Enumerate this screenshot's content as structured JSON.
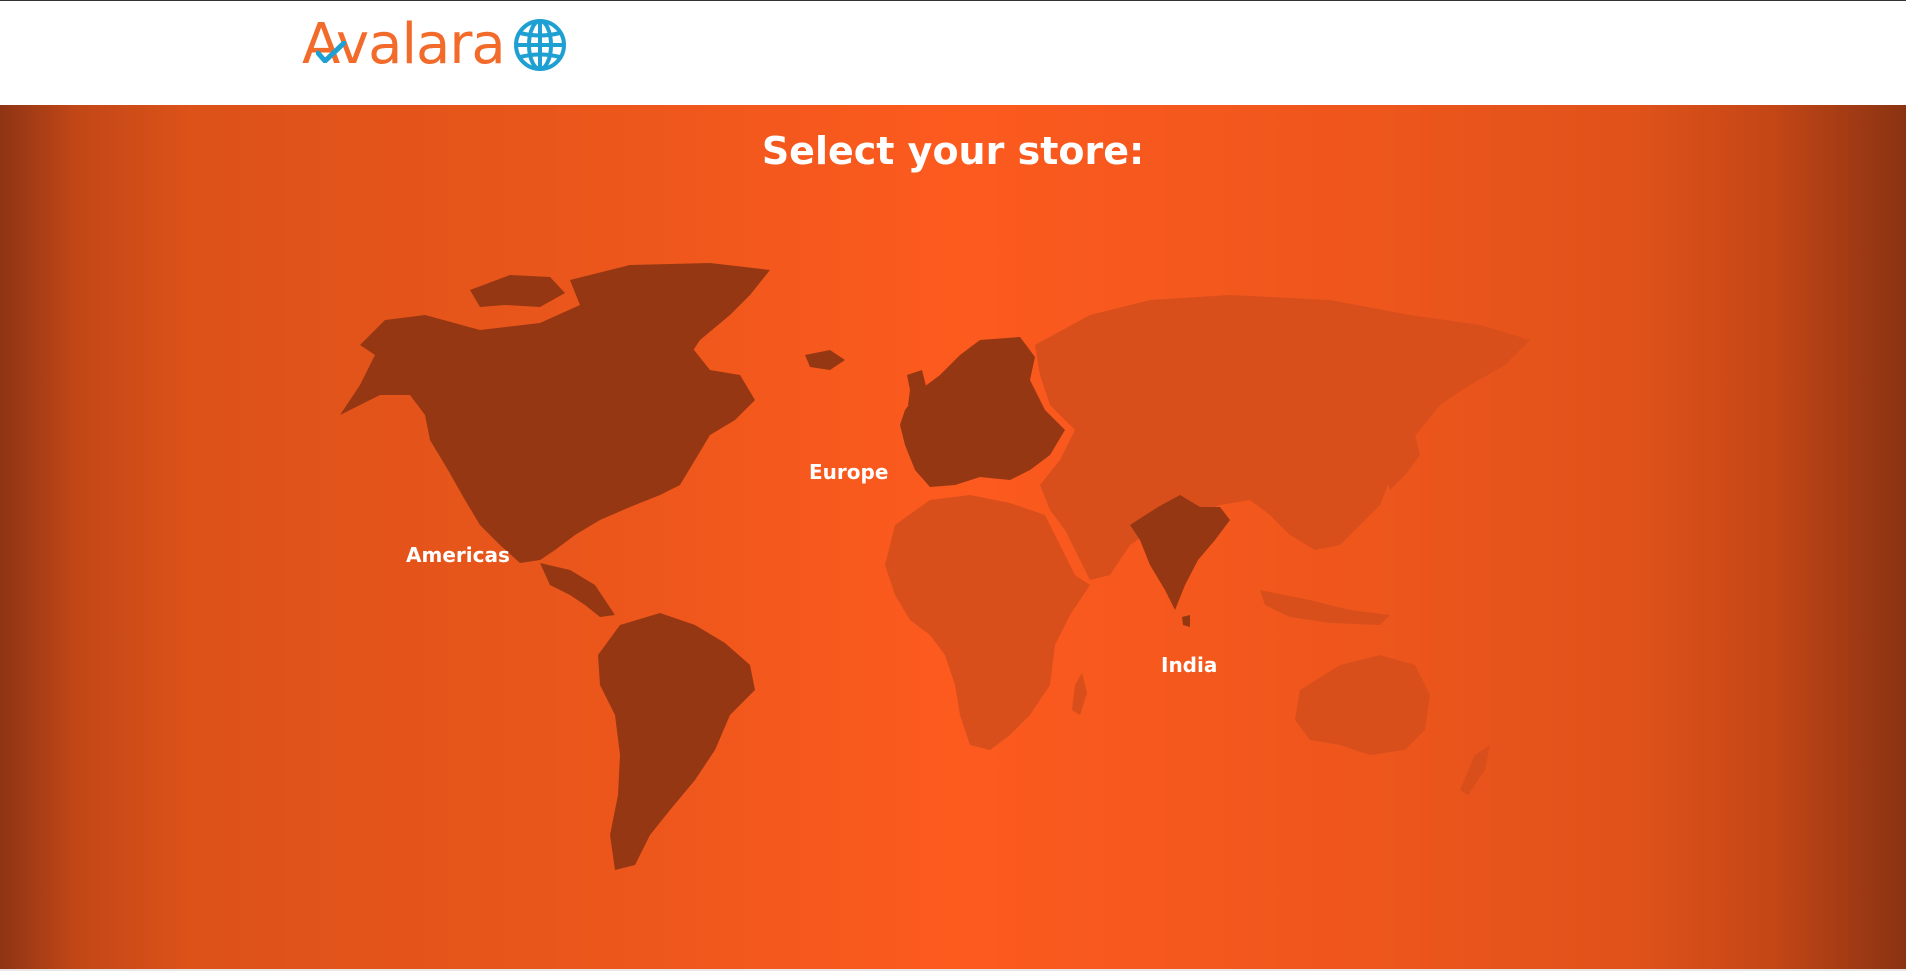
{
  "header": {
    "logo_text": "Avalara",
    "logo_icon": "globe-icon",
    "brand_color": "#f26b2a",
    "globe_color": "#1ea0d2"
  },
  "main": {
    "title": "Select your store:",
    "background_color": "#fd5a1e",
    "highlight_color": "#943712",
    "map_shade_color": "#d84f1c",
    "regions": [
      {
        "label": "Americas"
      },
      {
        "label": "Europe"
      },
      {
        "label": "India"
      }
    ]
  }
}
